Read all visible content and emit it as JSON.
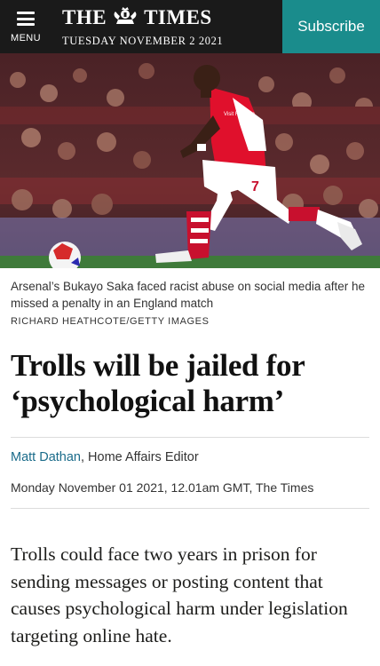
{
  "header": {
    "menu_label": "MENU",
    "logo_left": "THE",
    "logo_right": "TIMES",
    "date": "TUESDAY NOVEMBER 2 2021",
    "subscribe_label": "Subscribe",
    "background_color": "#1a1a1a",
    "subscribe_color": "#1a8c8c"
  },
  "hero": {
    "shirt_number": "7",
    "sponsor_text": "Visit Rwanda"
  },
  "article": {
    "caption": "Arsenal’s Bukayo Saka faced racist abuse on social media after he missed a penalty in an England match",
    "credit": "RICHARD HEATHCOTE/GETTY IMAGES",
    "headline": "Trolls will be jailed for ‘psychological harm’",
    "author": "Matt Dathan",
    "author_role": ", Home Affairs Editor",
    "dateline": "Monday November 01 2021, 12.01am GMT, The Times",
    "body": "Trolls could face two years in prison for sending messages or posting content that causes psychological harm under legislation targeting online hate.",
    "author_color": "#1a6b8a"
  }
}
